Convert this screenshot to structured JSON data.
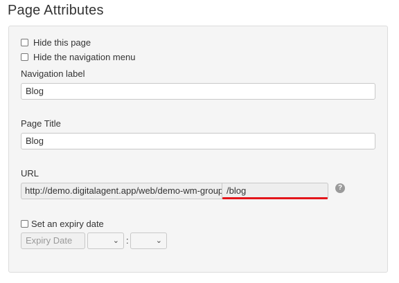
{
  "header": {
    "title": "Page Attributes"
  },
  "options": {
    "hide_page": "Hide this page",
    "hide_nav": "Hide the navigation menu"
  },
  "navigation": {
    "label": "Navigation label",
    "value": "Blog"
  },
  "page_title": {
    "label": "Page Title",
    "value": "Blog"
  },
  "url": {
    "label": "URL",
    "prefix": "http://demo.digitalagent.app/web/demo-wm-group",
    "slug": "/blog",
    "help_icon": "question-mark-icon"
  },
  "expiry": {
    "label": "Set an expiry date",
    "date_placeholder": "Expiry Date",
    "separator": ":"
  },
  "colors": {
    "highlight": "#e3151a",
    "panel_bg": "#f5f5f5"
  }
}
